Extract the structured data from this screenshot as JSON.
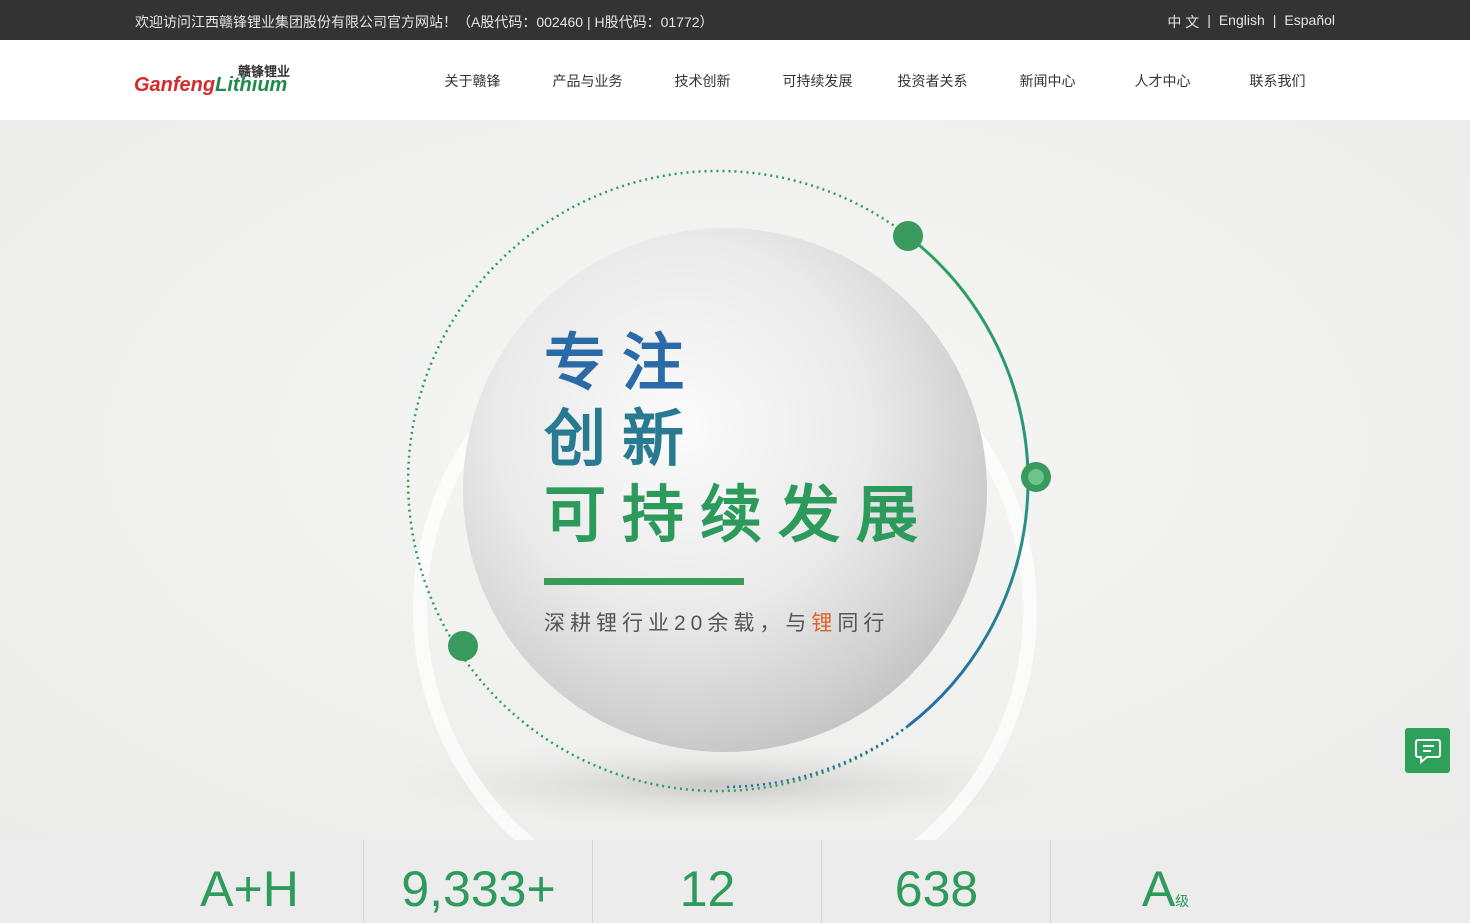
{
  "topbar": {
    "welcome": "欢迎访问江西赣锋锂业集团股份有限公司官方网站！（A股代码：002460 | H股代码：01772）",
    "lang_zh": "中 文",
    "lang_en": "English",
    "lang_es": "Español",
    "separator": "|"
  },
  "logo": {
    "cn": "赣锋锂业",
    "en_a": "Ganfeng",
    "en_b": "Lithium"
  },
  "nav": {
    "items": [
      "关于赣锋",
      "产品与业务",
      "技术创新",
      "可持续发展",
      "投资者关系",
      "新闻中心",
      "人才中心",
      "联系我们"
    ]
  },
  "hero": {
    "line1": "专注",
    "line2": "创新",
    "line3": "可持续发展",
    "sub_before": "深耕锂行业20余载，与",
    "sub_highlight": "锂",
    "sub_after": "同行"
  },
  "stats": [
    {
      "value": "A+H",
      "unit": ""
    },
    {
      "value": "9,333+",
      "unit": ""
    },
    {
      "value": "12",
      "unit": ""
    },
    {
      "value": "638",
      "unit": ""
    },
    {
      "value": "A",
      "unit": "级"
    }
  ],
  "colors": {
    "brand_green": "#2e9a5c",
    "brand_red": "#d62b2b",
    "topbar_bg": "#333333",
    "chat_green": "#2ea05a"
  },
  "icons": {
    "chat": "chat-bubble-icon"
  }
}
